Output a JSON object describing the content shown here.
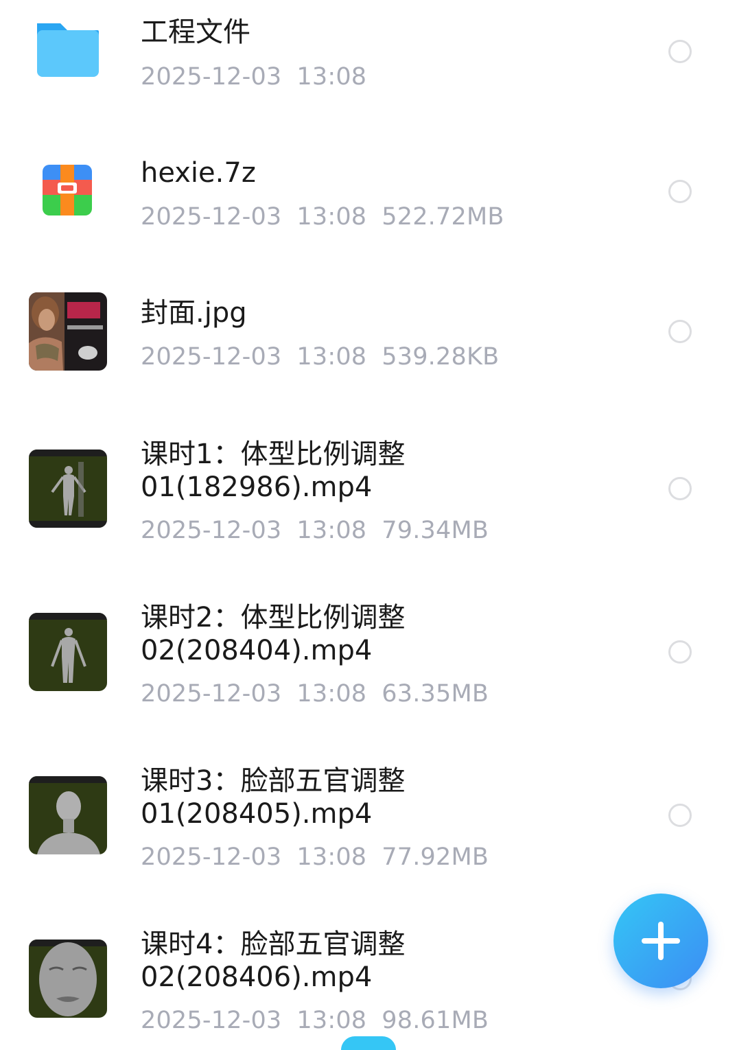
{
  "files": [
    {
      "name_lines": [
        "工程文件"
      ],
      "date": "2025-12-03",
      "time": "13:08",
      "size": "",
      "icon": "folder-icon"
    },
    {
      "name_lines": [
        "hexie.7z"
      ],
      "date": "2025-12-03",
      "time": "13:08",
      "size": "522.72MB",
      "icon": "archive-icon"
    },
    {
      "name_lines": [
        "封面.jpg"
      ],
      "date": "2025-12-03",
      "time": "13:08",
      "size": "539.28KB",
      "icon": "image-thumbnail"
    },
    {
      "name_lines": [
        "课时1：体型比例调整",
        "01(182986).mp4"
      ],
      "date": "2025-12-03",
      "time": "13:08",
      "size": "79.34MB",
      "icon": "video-thumbnail"
    },
    {
      "name_lines": [
        "课时2：体型比例调整",
        "02(208404).mp4"
      ],
      "date": "2025-12-03",
      "time": "13:08",
      "size": "63.35MB",
      "icon": "video-thumbnail"
    },
    {
      "name_lines": [
        "课时3：脸部五官调整",
        "01(208405).mp4"
      ],
      "date": "2025-12-03",
      "time": "13:08",
      "size": "77.92MB",
      "icon": "video-thumbnail"
    },
    {
      "name_lines": [
        "课时4：脸部五官调整",
        "02(208406).mp4"
      ],
      "date": "2025-12-03",
      "time": "13:08",
      "size": "98.61MB",
      "icon": "video-thumbnail"
    }
  ],
  "fab": {
    "icon": "plus-icon"
  },
  "colors": {
    "accent": "#3b8df4",
    "meta_text": "#a8abb6",
    "name_text": "#1a1a1a"
  }
}
